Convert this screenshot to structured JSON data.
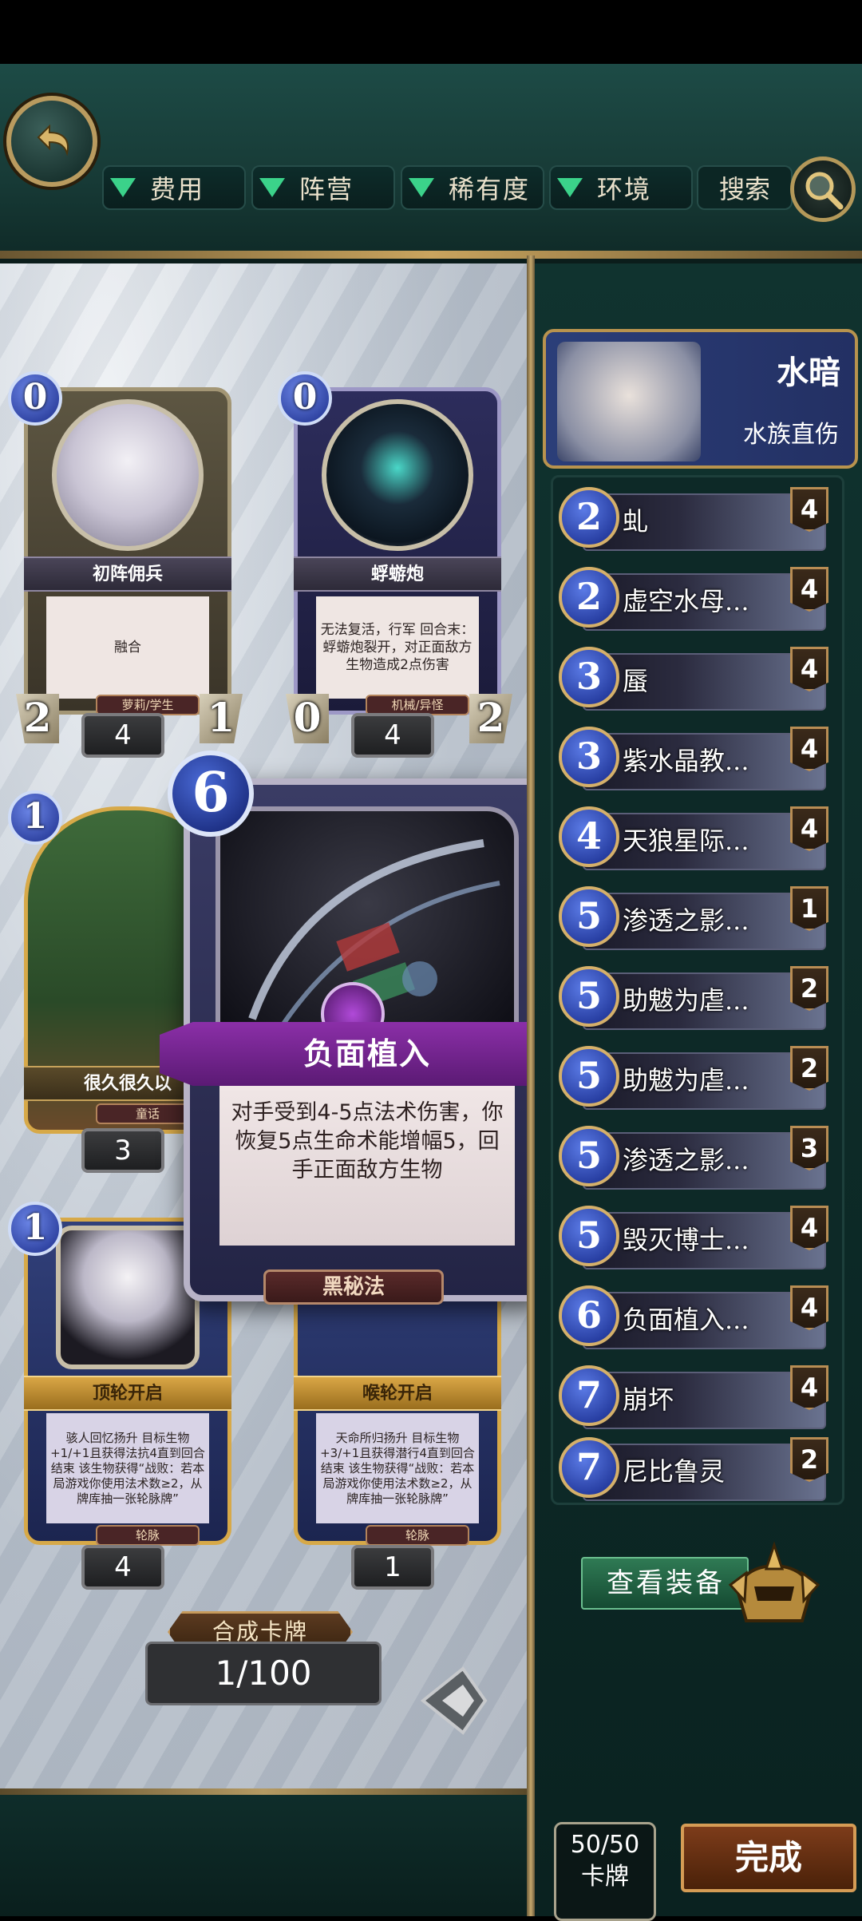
{
  "topbar": {
    "filters": [
      "费用",
      "阵营",
      "稀有度",
      "环境"
    ],
    "search_label": "搜索"
  },
  "cards": [
    {
      "cost": "0",
      "name": "初阵佣兵",
      "desc": "融合",
      "tag": "萝莉/学生",
      "attack": "2",
      "health": "1",
      "count": "4"
    },
    {
      "cost": "0",
      "name": "蜉蝣炮",
      "desc": "无法复活，行军 回合末：蜉蝣炮裂开，对正面敌方生物造成2点伤害",
      "tag": "机械/异怪",
      "attack": "0",
      "health": "2",
      "count": "4"
    },
    {
      "cost": "1",
      "name": "很久很久以",
      "tag": "童话",
      "count": "3"
    },
    {
      "cost": "1",
      "name": "顶轮开启",
      "desc": "骇人回忆扬升 目标生物+1/+1且获得法抗4直到回合结束 该生物获得“战败：若本局游戏你使用法术数≥2，从牌库抽一张轮脉牌”",
      "tag": "轮脉",
      "count": "4"
    },
    {
      "name": "喉轮开启",
      "desc": "天命所归扬升 目标生物+3/+1且获得潜行4直到回合结束 该生物获得“战败：若本局游戏你使用法术数≥2，从牌库抽一张轮脉牌”",
      "tag": "轮脉",
      "count": "1"
    }
  ],
  "zoom_card": {
    "cost": "6",
    "name": "负面植入",
    "desc": "对手受到4-5点法术伤害，你恢复5点生命术能增幅5，回手正面敌方生物",
    "tag": "黑秘法"
  },
  "hero": {
    "name": "水暗",
    "subtitle": "水族直伤"
  },
  "deck": [
    {
      "cost": "2",
      "name": "虬",
      "qty": "4"
    },
    {
      "cost": "2",
      "name": "虚空水母...",
      "qty": "4"
    },
    {
      "cost": "3",
      "name": "蜃",
      "qty": "4"
    },
    {
      "cost": "3",
      "name": "紫水晶教...",
      "qty": "4"
    },
    {
      "cost": "4",
      "name": "天狼星际...",
      "qty": "4"
    },
    {
      "cost": "5",
      "name": "渗透之影...",
      "qty": "1"
    },
    {
      "cost": "5",
      "name": "助魃为虐...",
      "qty": "2"
    },
    {
      "cost": "5",
      "name": "助魃为虐...",
      "qty": "2"
    },
    {
      "cost": "5",
      "name": "渗透之影...",
      "qty": "3"
    },
    {
      "cost": "5",
      "name": "毁灭博士...",
      "qty": "4"
    },
    {
      "cost": "6",
      "name": "负面植入...",
      "qty": "4"
    },
    {
      "cost": "7",
      "name": "崩坏",
      "qty": "4"
    },
    {
      "cost": "7",
      "name": "尼比鲁灵",
      "qty": "2"
    }
  ],
  "equip_label": "查看装备",
  "card_total": {
    "count": "50/50",
    "label": "卡牌"
  },
  "done_label": "完成",
  "compose_label": "合成卡牌",
  "page": "1/100"
}
